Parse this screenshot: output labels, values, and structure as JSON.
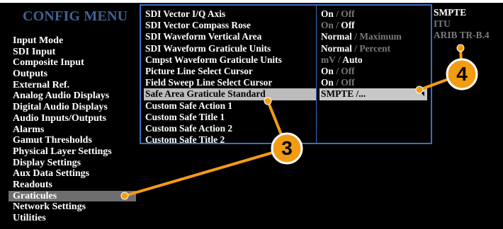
{
  "title": "CONFIG MENU",
  "left_menu": [
    "Input Mode",
    "SDI Input",
    "Composite Input",
    "Outputs",
    "External Ref.",
    "Analog Audio Displays",
    "Digital Audio Displays",
    "Audio Inputs/Outputs",
    "Alarms",
    "Gamut Thresholds",
    "Physical Layer Settings",
    "Display Settings",
    "Aux Data Settings",
    "Readouts",
    "Graticules",
    "Network Settings",
    "Utilities"
  ],
  "left_selected": "Graticules",
  "parameters": [
    "SDI Vector I/Q Axis",
    "SDI Vector Compass Rose",
    "SDI Waveform Vertical Area",
    "SDI Waveform Graticule Units",
    "Cmpst Waveform Graticule Units",
    "Picture Line Select Cursor",
    "Field Sweep Line Select Cursor",
    "Safe Area Graticule Standard",
    "Custom Safe Action 1",
    "Custom Safe Title  1",
    "Custom Safe Action 2",
    "Custom Safe Title  2"
  ],
  "parameter_selected": "Safe Area Graticule Standard",
  "values": [
    {
      "a": "On",
      "sep": " / ",
      "b": "Off",
      "active": "a"
    },
    {
      "a": "On",
      "sep": " / ",
      "b": "Off",
      "active": "b"
    },
    {
      "a": "Normal",
      "sep": " / ",
      "b": "Maximum",
      "active": "a"
    },
    {
      "a": "Normal",
      "sep": " / ",
      "b": "Percent",
      "active": "a"
    },
    {
      "a": "mV",
      "sep": " / ",
      "b": "Auto",
      "active": "b"
    },
    {
      "a": "On",
      "sep": " / ",
      "b": "Off",
      "active": "a"
    },
    {
      "a": "On",
      "sep": " / ",
      "b": "Off",
      "active": "a"
    },
    {
      "a": "SMPTE /...",
      "sep": "",
      "b": "",
      "active": "a"
    }
  ],
  "options": [
    "SMPTE",
    "ITU",
    "ARIB TR-B.4"
  ],
  "option_current": "SMPTE",
  "callouts": [
    "3",
    "4"
  ],
  "colors": {
    "background": "#000000",
    "title": "#3e6296",
    "panel_border": "#3a6ec0",
    "highlight": "#bcbcbc",
    "left_highlight": "#6e6e6e",
    "dim_text": "#7a7a7a",
    "callout_fill": "#f39c12",
    "callout_line": "#f39c12"
  }
}
